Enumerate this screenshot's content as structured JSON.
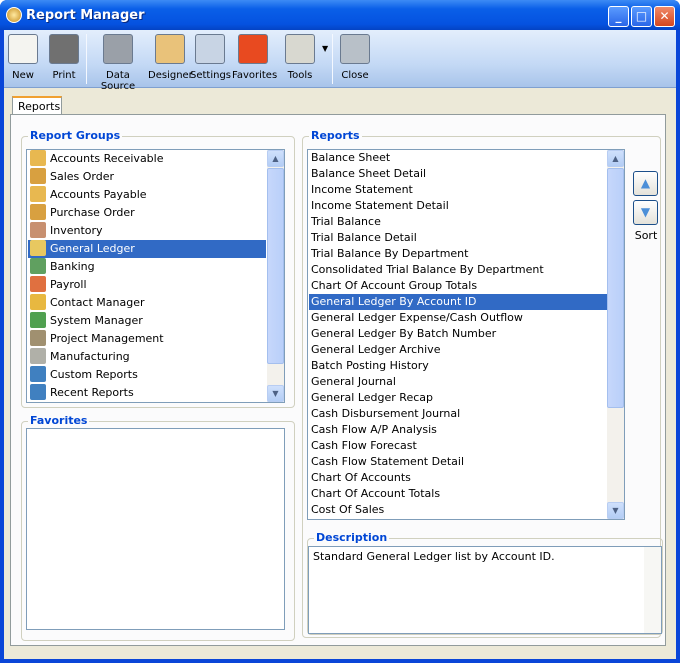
{
  "window": {
    "title": "Report Manager",
    "controls": [
      "minimize",
      "maximize",
      "close"
    ]
  },
  "toolbar": {
    "buttons": [
      {
        "label": "New",
        "icon": "new-report-icon",
        "color": "#f4f4f0"
      },
      {
        "label": "Print",
        "icon": "printer-icon",
        "color": "#707070"
      },
      {
        "label": "Data Source",
        "icon": "database-icon",
        "color": "#9aa0a8"
      },
      {
        "label": "Designer",
        "icon": "designer-icon",
        "color": "#e9c27a"
      },
      {
        "label": "Settings",
        "icon": "settings-icon",
        "color": "#c8d4e4"
      },
      {
        "label": "Favorites",
        "icon": "favorites-icon",
        "color": "#e84a20"
      },
      {
        "label": "Tools",
        "icon": "tools-icon",
        "color": "#d8d8d0"
      },
      {
        "label": "Close",
        "icon": "close-report-icon",
        "color": "#b8c0c8"
      }
    ]
  },
  "tabs": [
    {
      "label": "Reports",
      "active": true
    }
  ],
  "report_groups": {
    "title": "Report Groups",
    "selected": "General Ledger",
    "items": [
      {
        "label": "Accounts Receivable",
        "color": "#e8b850"
      },
      {
        "label": "Sales Order",
        "color": "#d8a040"
      },
      {
        "label": "Accounts Payable",
        "color": "#e8b850"
      },
      {
        "label": "Purchase Order",
        "color": "#d8a040"
      },
      {
        "label": "Inventory",
        "color": "#c89070"
      },
      {
        "label": "General Ledger",
        "color": "#e8c860"
      },
      {
        "label": "Banking",
        "color": "#60a060"
      },
      {
        "label": "Payroll",
        "color": "#e07040"
      },
      {
        "label": "Contact Manager",
        "color": "#e8b840"
      },
      {
        "label": "System Manager",
        "color": "#50a050"
      },
      {
        "label": "Project Management",
        "color": "#a09070"
      },
      {
        "label": "Manufacturing",
        "color": "#b0b0a8"
      },
      {
        "label": "Custom Reports",
        "color": "#4080c0"
      },
      {
        "label": "Recent Reports",
        "color": "#4080c0"
      }
    ]
  },
  "favorites": {
    "title": "Favorites",
    "items": []
  },
  "reports": {
    "title": "Reports",
    "selected": "General Ledger By Account ID",
    "items": [
      "Balance Sheet",
      "Balance Sheet Detail",
      "Income Statement",
      "Income Statement Detail",
      "Trial Balance",
      "Trial Balance Detail",
      "Trial Balance By Department",
      "Consolidated Trial Balance By Department",
      "Chart Of Account Group Totals",
      "General Ledger By Account ID",
      "General Ledger Expense/Cash Outflow",
      "General Ledger By Batch Number",
      "General Ledger Archive",
      "Batch Posting History",
      "General Journal",
      "General Ledger Recap",
      "Cash Disbursement Journal",
      "Cash Flow A/P Analysis",
      "Cash Flow Forecast",
      "Cash Flow Statement Detail",
      "Chart Of Accounts",
      "Chart Of Account Totals",
      "Cost Of Sales"
    ]
  },
  "sort": {
    "label": "Sort"
  },
  "description": {
    "title": "Description",
    "text": "Standard General Ledger list by Account ID."
  }
}
